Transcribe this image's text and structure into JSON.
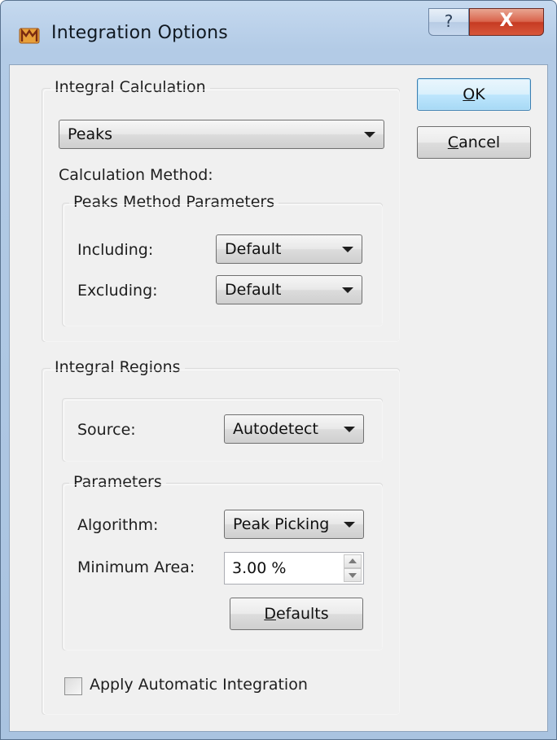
{
  "window": {
    "title": "Integration Options",
    "app_icon": "mnova-icon",
    "help_glyph": "?",
    "close_glyph": "X"
  },
  "buttons": {
    "ok_label_access": "O",
    "ok_label_rest": "K",
    "cancel_label_access": "C",
    "cancel_label_rest": "ancel"
  },
  "integral_calculation": {
    "group_label": "Integral Calculation",
    "mode_value": "Peaks",
    "method_label": "Calculation Method:",
    "peaks_params": {
      "group_label": "Peaks Method Parameters",
      "including_label": "Including:",
      "including_value": "Default",
      "excluding_label": "Excluding:",
      "excluding_value": "Default"
    }
  },
  "integral_regions": {
    "group_label": "Integral Regions",
    "source_label": "Source:",
    "source_value": "Autodetect",
    "parameters": {
      "group_label": "Parameters",
      "algorithm_label": "Algorithm:",
      "algorithm_value": "Peak Picking",
      "min_area_label": "Minimum Area:",
      "min_area_value": "3.00 %",
      "defaults_access": "D",
      "defaults_rest": "efaults"
    },
    "auto_integration_label": "Apply Automatic Integration",
    "auto_integration_checked": false
  },
  "colors": {
    "frame": "#b3cbe6",
    "client_bg": "#f0f0f0",
    "close_red": "#c63b22",
    "default_button_blue": "#3c7fb1"
  }
}
